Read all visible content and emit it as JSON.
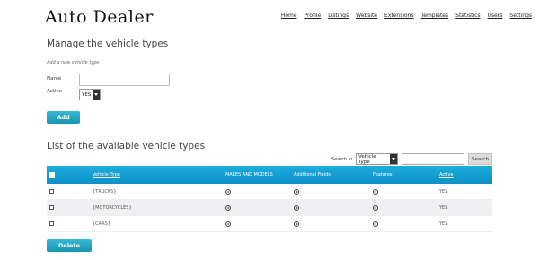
{
  "brand": "Auto Dealer",
  "nav": [
    "Home",
    "Profile",
    "Listings",
    "Website",
    "Extensions",
    "Templates",
    "Statistics",
    "Users",
    "Settings"
  ],
  "form": {
    "heading": "Manage the vehicle types",
    "subheading": "Add a new vehicle type",
    "name_label": "Name",
    "name_value": "",
    "active_label": "Active",
    "active_value": "YES",
    "add_button": "Add"
  },
  "list": {
    "heading": "List of the available vehicle types",
    "search_label": "Search in",
    "search_field": "Vehicle Type",
    "search_value": "",
    "search_button": "Search",
    "columns": {
      "vehicle_type": "Vehicle Type",
      "makes_models": "MAKES AND MODELS",
      "additional_fields": "Additional Fields",
      "features": "Features",
      "active": "Active"
    },
    "rows": [
      {
        "type": "{TRUCKS}",
        "active": "YES"
      },
      {
        "type": "{MOTORCYCLES}",
        "active": "YES"
      },
      {
        "type": "{CARS}",
        "active": "YES"
      }
    ],
    "delete_button": "Delete"
  },
  "icons": {
    "row_action": "arrow-circle-icon",
    "dropdown": "chevron-down-icon"
  },
  "colors": {
    "accent": "#1a9ec2",
    "table_header": "#149fd4"
  }
}
